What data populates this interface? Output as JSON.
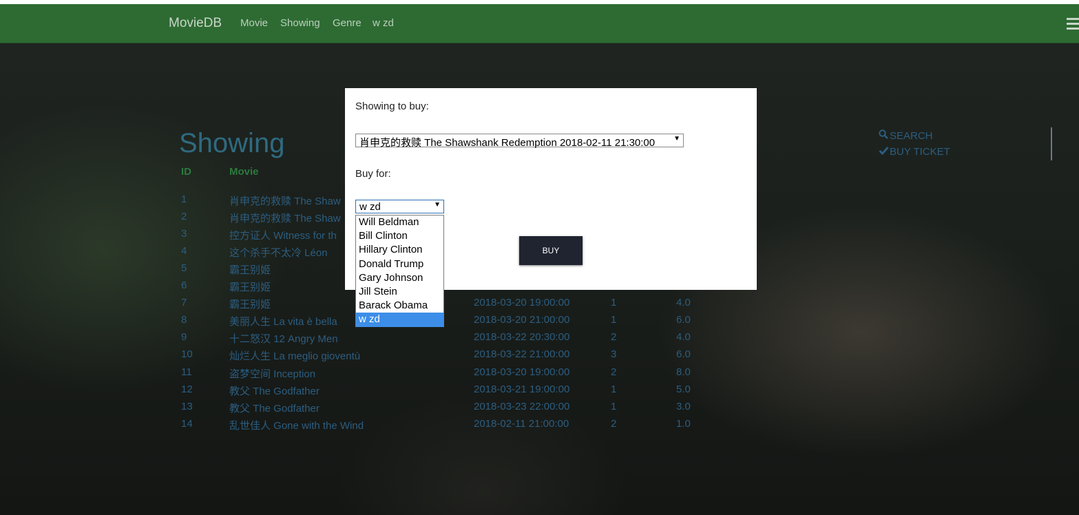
{
  "navbar": {
    "brand": "MovieDB",
    "links": [
      "Movie",
      "Showing",
      "Genre",
      "w zd"
    ]
  },
  "page": {
    "title": "Showing",
    "headers": [
      "ID",
      "Movie"
    ],
    "rows": [
      {
        "id": "1",
        "movie": "肖申克的救赎 The Shaw",
        "time": "",
        "hall": "",
        "price": ""
      },
      {
        "id": "2",
        "movie": "肖申克的救赎 The Shaw",
        "time": "",
        "hall": "",
        "price": ""
      },
      {
        "id": "3",
        "movie": "控方证人 Witness for th",
        "time": "",
        "hall": "",
        "price": ""
      },
      {
        "id": "4",
        "movie": "这个杀手不太冷 Léon",
        "time": "",
        "hall": "",
        "price": ""
      },
      {
        "id": "5",
        "movie": "霸王别姬",
        "time": "",
        "hall": "",
        "price": ""
      },
      {
        "id": "6",
        "movie": "霸王别姬",
        "time": "",
        "hall": "",
        "price": ""
      },
      {
        "id": "7",
        "movie": "霸王别姬",
        "time": "2018-03-20 19:00:00",
        "hall": "1",
        "price": "4.0"
      },
      {
        "id": "8",
        "movie": "美丽人生 La vita è bella",
        "time": "2018-03-20 21:00:00",
        "hall": "1",
        "price": "6.0"
      },
      {
        "id": "9",
        "movie": "十二怒汉 12 Angry Men",
        "time": "2018-03-22 20:30:00",
        "hall": "2",
        "price": "4.0"
      },
      {
        "id": "10",
        "movie": "灿烂人生 La meglio gioventù",
        "time": "2018-03-22 21:00:00",
        "hall": "3",
        "price": "6.0"
      },
      {
        "id": "11",
        "movie": "盗梦空间 Inception",
        "time": "2018-03-20 19:00:00",
        "hall": "2",
        "price": "8.0"
      },
      {
        "id": "12",
        "movie": "教父 The Godfather",
        "time": "2018-03-21 19:00:00",
        "hall": "1",
        "price": "5.0"
      },
      {
        "id": "13",
        "movie": "教父 The Godfather",
        "time": "2018-03-23 22:00:00",
        "hall": "1",
        "price": "3.0"
      },
      {
        "id": "14",
        "movie": "乱世佳人 Gone with the Wind",
        "time": "2018-02-11 21:00:00",
        "hall": "2",
        "price": "1.0"
      }
    ]
  },
  "side": {
    "search_label": "SEARCH",
    "buy_ticket_label": "BUY TICKET"
  },
  "modal": {
    "showing_label": "Showing to buy:",
    "showing_value": "肖申克的救赎 The Shawshank Redemption 2018-02-11 21:30:00",
    "buy_for_label": "Buy for:",
    "buy_for_value": "w zd",
    "buy_button": "BUY",
    "options": [
      "Will Beldman",
      "Bill Clinton",
      "Hillary Clinton",
      "Donald Trump",
      "Gary Johnson",
      "Jill Stein",
      "Barack Obama",
      "w zd"
    ],
    "selected_option": "w zd"
  },
  "colors": {
    "navbar": "#2e6b33",
    "link_blue": "#2c5d80",
    "header_green": "#2b7a3d",
    "button_dark": "#1f2430",
    "option_selected": "#3d8ee8"
  }
}
